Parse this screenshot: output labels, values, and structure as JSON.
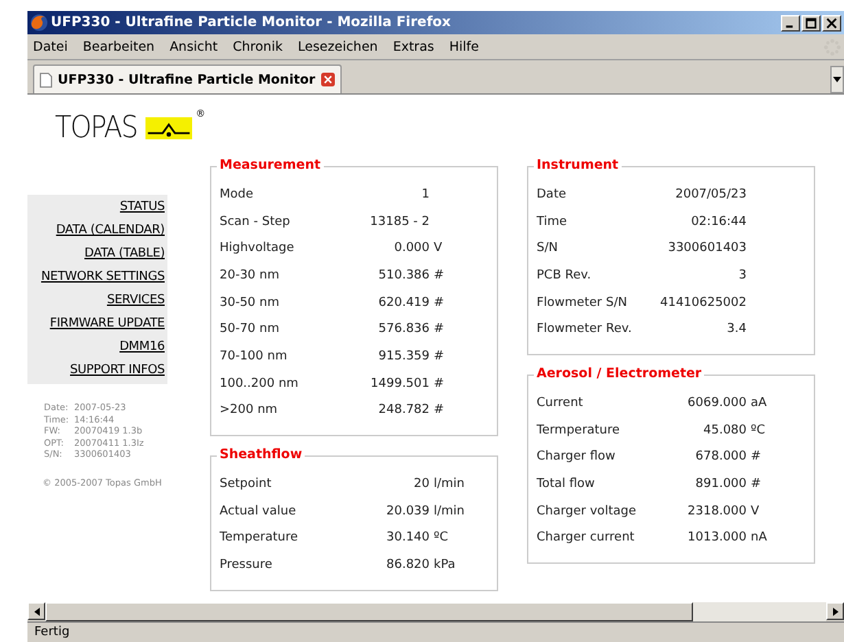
{
  "window": {
    "title": "UFP330 - Ultrafine Particle Monitor - Mozilla Firefox"
  },
  "menu": [
    "Datei",
    "Bearbeiten",
    "Ansicht",
    "Chronik",
    "Lesezeichen",
    "Extras",
    "Hilfe"
  ],
  "tabs": [
    {
      "label": "UFP330 - Ultrafine Particle Monitor",
      "selected": true
    }
  ],
  "logo": {
    "text": "TOPAS",
    "mark": "®"
  },
  "sidebar": {
    "items": [
      "STATUS",
      "DATA (CALENDAR)",
      "DATA (TABLE)",
      "NETWORK SETTINGS",
      "SERVICES",
      "FIRMWARE UPDATE",
      "DMM16",
      "SUPPORT INFOS"
    ],
    "info": [
      {
        "label": "Date:",
        "value": "2007-05-23"
      },
      {
        "label": "Time:",
        "value": "14:16:44"
      },
      {
        "label": "FW:",
        "value": "20070419 1.3b"
      },
      {
        "label": "OPT:",
        "value": "20070411 1.3Iz"
      },
      {
        "label": "S/N:",
        "value": "3300601403"
      }
    ],
    "copyright": "© 2005-2007 Topas GmbH"
  },
  "columns": [
    [
      {
        "title": "Measurement",
        "rows": [
          {
            "label": "Mode",
            "value": "1"
          },
          {
            "label": "Scan - Step",
            "value": "13185 - 2"
          },
          {
            "label": "Highvoltage",
            "value": "0.000",
            "unit": "V"
          },
          {
            "label": "20-30 nm",
            "value": "510.386",
            "unit": "#"
          },
          {
            "label": "30-50 nm",
            "value": "620.419",
            "unit": "#"
          },
          {
            "label": "50-70 nm",
            "value": "576.836",
            "unit": "#"
          },
          {
            "label": "70-100 nm",
            "value": "915.359",
            "unit": "#"
          },
          {
            "label": "100..200 nm",
            "value": "1499.501",
            "unit": "#"
          },
          {
            "label": ">200 nm",
            "value": "248.782",
            "unit": "#"
          }
        ]
      },
      {
        "title": "Sheathflow",
        "rows": [
          {
            "label": "Setpoint",
            "value": "20",
            "unit": "l/min"
          },
          {
            "label": "Actual value",
            "value": "20.039",
            "unit": "l/min"
          },
          {
            "label": "Temperature",
            "value": "30.140",
            "unit": "ºC"
          },
          {
            "label": "Pressure",
            "value": "86.820",
            "unit": "kPa"
          }
        ]
      }
    ],
    [
      {
        "title": "Instrument",
        "rows": [
          {
            "label": "Date",
            "value": "2007/05/23"
          },
          {
            "label": "Time",
            "value": "02:16:44"
          },
          {
            "label": "S/N",
            "value": "3300601403"
          },
          {
            "label": "PCB Rev.",
            "value": "3"
          },
          {
            "label": "Flowmeter S/N",
            "value": "41410625002"
          },
          {
            "label": "Flowmeter Rev.",
            "value": "3.4"
          }
        ]
      },
      {
        "title": "Aerosol / Electrometer",
        "rows": [
          {
            "label": "Current",
            "value": "6069.000",
            "unit": "aA"
          },
          {
            "label": "Termperature",
            "value": "45.080",
            "unit": "ºC"
          },
          {
            "label": "Charger flow",
            "value": "678.000",
            "unit": "#"
          },
          {
            "label": "Total flow",
            "value": "891.000",
            "unit": "#"
          },
          {
            "label": "Charger voltage",
            "value": "2318.000",
            "unit": "V"
          },
          {
            "label": "Charger current",
            "value": "1013.000",
            "unit": "nA"
          }
        ]
      }
    ]
  ],
  "status_bar": "Fertig"
}
